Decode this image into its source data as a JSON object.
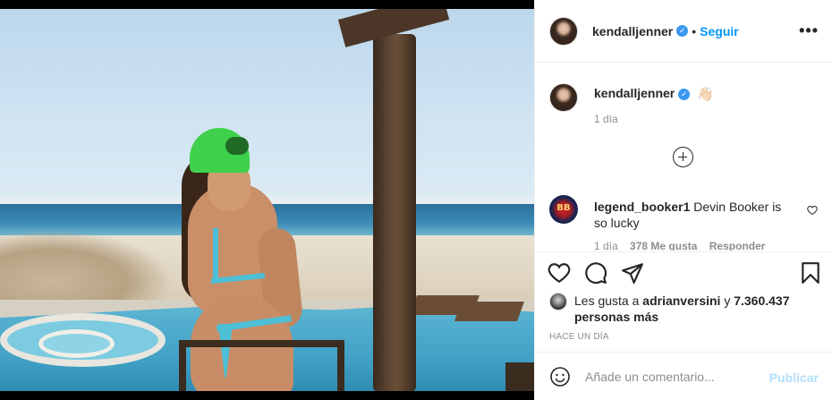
{
  "post": {
    "author": "kendalljenner",
    "follow_label": "Seguir",
    "more_icon": "more-options-icon",
    "more_symbol": "•••",
    "verified_symbol": "✓"
  },
  "caption": {
    "username": "kendalljenner",
    "emoji": "👋🏻",
    "time": "1 día"
  },
  "comment": {
    "username": "legend_booker1",
    "text": "Devin Booker is so lucky",
    "time": "1 día",
    "likes": "378 Me gusta",
    "reply": "Responder"
  },
  "likes": {
    "prefix": "Les gusta a",
    "user": "adrianversini",
    "connector": "y",
    "count": "7.360.437 personas más"
  },
  "posted_time": "HACE UN DÍA",
  "add_comment": {
    "placeholder": "Añade un comentario...",
    "publish_label": "Publicar"
  },
  "colors": {
    "link_blue": "#0095f6",
    "publish_disabled": "#b2dffc",
    "verified": "#3897f0"
  }
}
